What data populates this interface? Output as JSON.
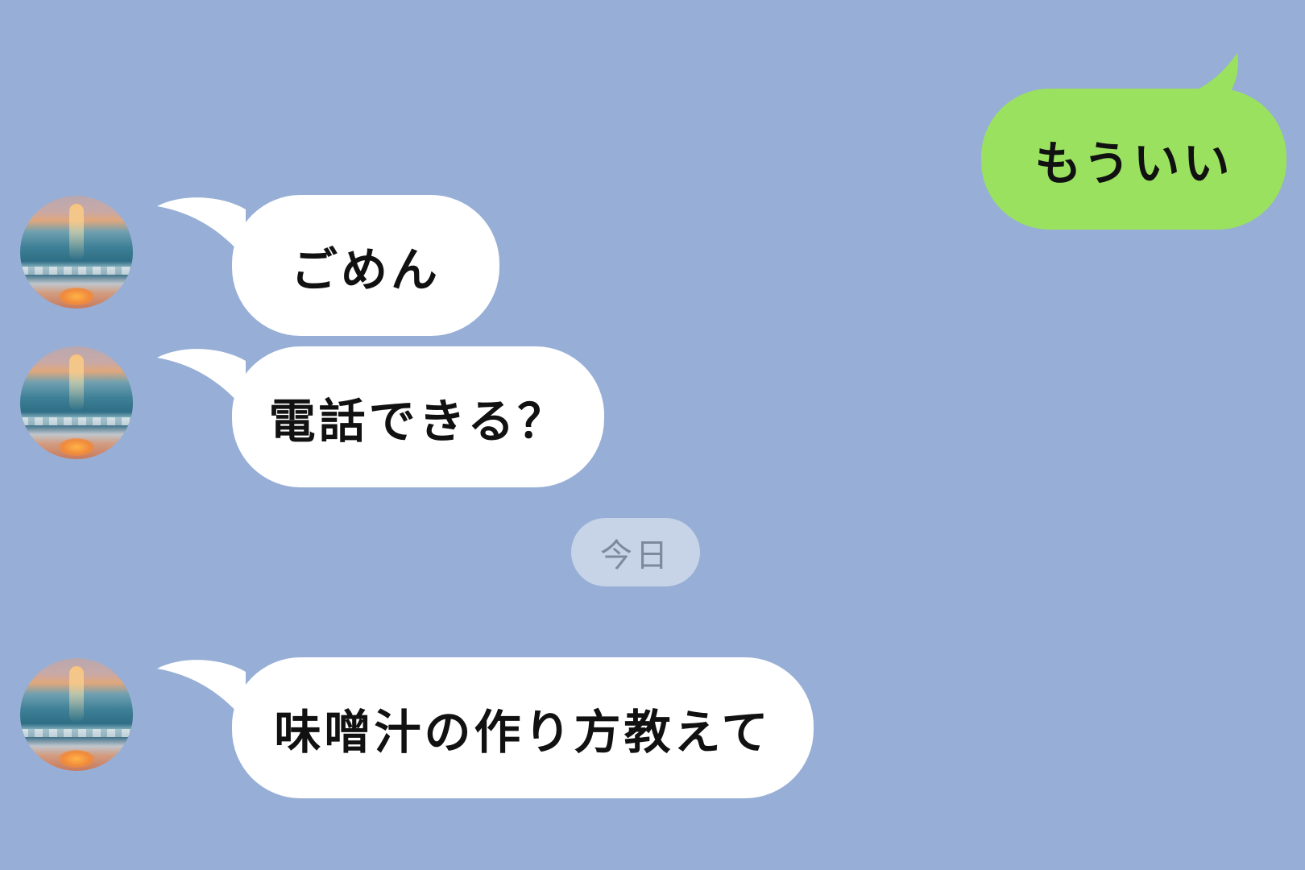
{
  "chat": {
    "messages": [
      {
        "side": "outgoing",
        "text": "もういい"
      },
      {
        "side": "incoming",
        "text": "ごめん"
      },
      {
        "side": "incoming",
        "text": "電話できる？"
      },
      {
        "side": "incoming",
        "text": "味噌汁の作り方教えて"
      }
    ],
    "date_separator": "今日"
  },
  "colors": {
    "background": "#97aed6",
    "incoming_bubble": "#ffffff",
    "outgoing_bubble": "#9ae15f",
    "date_pill": "#c7d3e7",
    "date_text": "#7d8a9e"
  },
  "icons": {
    "avatar": "sunset-sea-avatar"
  }
}
